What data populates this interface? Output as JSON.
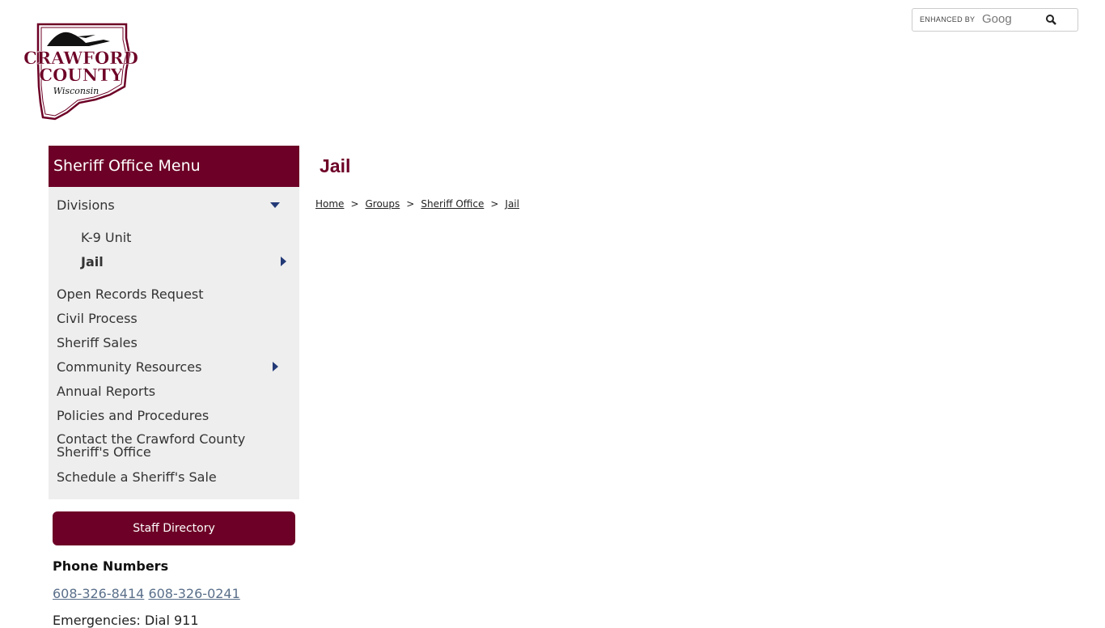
{
  "logo": {
    "line1": "CRAWFORD",
    "line2": "COUNTY",
    "line3": "Wisconsin"
  },
  "search": {
    "enhanced_by": "ENHANCED BY",
    "brand": "Goog",
    "icon": "search-icon"
  },
  "sidebar": {
    "title": "Sheriff Office Menu",
    "items": [
      {
        "label": "Divisions",
        "icon": "chevron-down-icon"
      },
      {
        "label": "K-9 Unit"
      },
      {
        "label": "Jail",
        "icon": "chevron-right-icon",
        "active": true
      },
      {
        "label": "Open Records Request"
      },
      {
        "label": "Civil Process"
      },
      {
        "label": "Sheriff Sales"
      },
      {
        "label": "Community Resources",
        "icon": "chevron-right-icon"
      },
      {
        "label": "Annual Reports"
      },
      {
        "label": "Policies and Procedures"
      },
      {
        "label": "Contact the Crawford County",
        "label2": "Sheriff's Office"
      },
      {
        "label": "Schedule a Sheriff's Sale"
      }
    ],
    "staff_button": "Staff Directory",
    "phone_heading": "Phone Numbers",
    "phones": [
      "608-326-8414",
      "608-326-0241"
    ],
    "emergency": "Emergencies: Dial 911"
  },
  "main": {
    "title": "Jail",
    "breadcrumb": [
      "Home",
      "Groups",
      "Sheriff Office",
      "Jail"
    ],
    "breadcrumb_sep": ">"
  },
  "colors": {
    "brand": "#6d0026",
    "arrow": "#233a77",
    "link": "#5a6f8a",
    "nav_bg": "#eeeeee"
  }
}
